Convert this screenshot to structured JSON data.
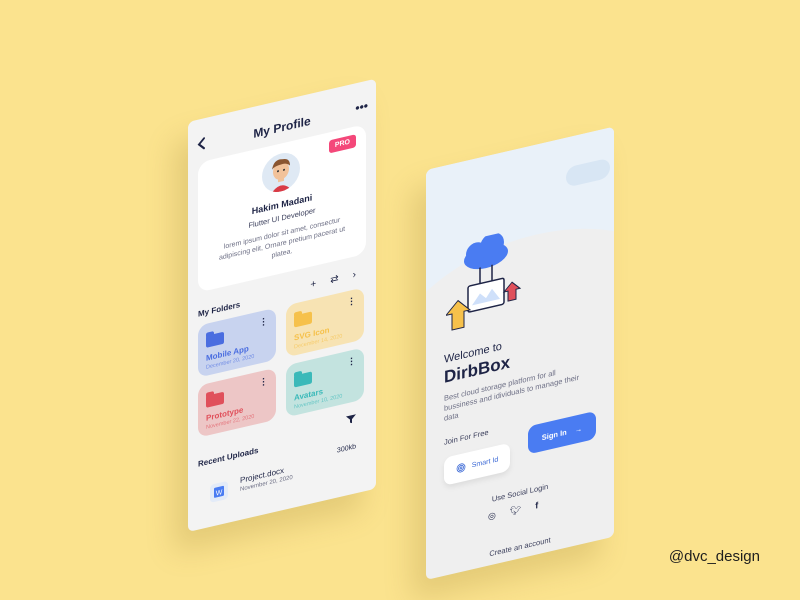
{
  "profile_screen": {
    "title": "My Profile",
    "back_icon": "chevron-left-icon",
    "more_icon": "more-horizontal-icon",
    "more_glyph": "•••",
    "badge": "PRO",
    "name": "Hakim Madani",
    "role": "Flutter UI Developer",
    "bio": "lorem ipsum dolor sit amet, consectur adipiscing elit, Ornare pretium pacerat ut platea.",
    "folders_title": "My Folders",
    "folder_actions": [
      "+",
      "⇄",
      "›"
    ],
    "folders": [
      {
        "name": "Mobile App",
        "date": "December 20, 2020",
        "color": "#4a6de0",
        "bg": "#c8d3ef"
      },
      {
        "name": "SVG Icon",
        "date": "December 14, 2020",
        "color": "#f6c14b",
        "bg": "#f7e3b3"
      },
      {
        "name": "Prototype",
        "date": "November 22, 2020",
        "color": "#e0505b",
        "bg": "#edc6c6"
      },
      {
        "name": "Avatars",
        "date": "November 10, 2020",
        "color": "#3bb9b9",
        "bg": "#c3e3df"
      }
    ],
    "menu_glyph": "⋮",
    "uploads_title": "Recent Uploads",
    "upload": {
      "name": "Project.docx",
      "date": "November 20, 2020",
      "size": "300kb"
    }
  },
  "welcome_screen": {
    "welcome": "Welcome to",
    "app_name": "DirbBox",
    "description": "Best cloud storage platform for all bussiness and idividuals to manage their data",
    "join": "Join For Free",
    "smart_id": "Smart Id",
    "sign_in": "Sign In",
    "sign_in_arrow": "→",
    "social_label": "Use Social Login",
    "social_icons": [
      "instagram-icon",
      "twitter-icon",
      "facebook-icon"
    ],
    "social_glyphs": [
      "◎",
      "🐦︎",
      "f"
    ],
    "create_account": "Create an account"
  },
  "credit": "@dvc_design"
}
